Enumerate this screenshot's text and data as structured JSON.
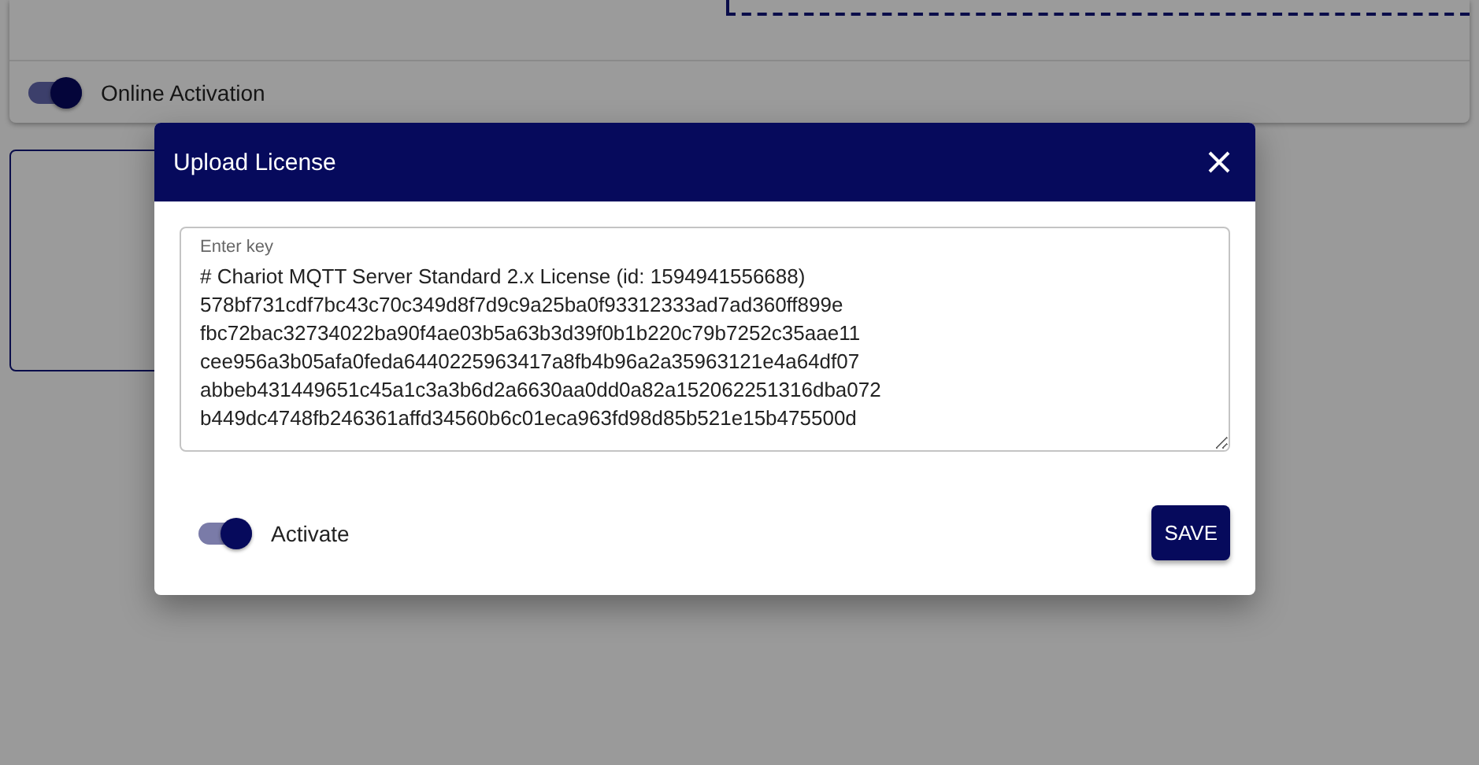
{
  "background": {
    "toggle": {
      "label": "Online Activation",
      "on": true
    }
  },
  "dialog": {
    "title": "Upload License",
    "key_field": {
      "label": "Enter key",
      "value": "# Chariot MQTT Server Standard 2.x License (id: 1594941556688)\n578bf731cdf7bc43c70c349d8f7d9c9a25ba0f93312333ad7ad360ff899e\nfbc72bac32734022ba90f4ae03b5a63b3d39f0b1b220c79b7252c35aae11\ncee956a3b05afa0feda6440225963417a8fb4b96a2a35963121e4a64df07\nabbeb431449651c45a1c3a3b6d2a6630aa0dd0a82a152062251316dba072\nb449dc4748fb246361affd34560b6c01eca963fd98d85b521e15b475500d"
    },
    "toggle": {
      "label": "Activate",
      "on": true
    },
    "save_button": "SAVE"
  }
}
